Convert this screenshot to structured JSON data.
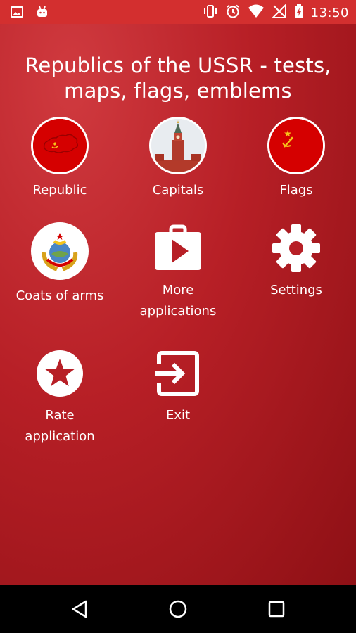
{
  "status_bar": {
    "time": "13:50",
    "icons": [
      "image-icon",
      "android-icon",
      "vibrate-icon",
      "alarm-icon",
      "wifi-icon",
      "no-signal-icon",
      "battery-charging-icon"
    ]
  },
  "app": {
    "title": "Republics of the USSR - tests, maps, flags, emblems"
  },
  "menu": {
    "republic": "Republic",
    "capitals": "Capitals",
    "flags": "Flags",
    "coats_of_arms": "Coats of arms",
    "more_applications": "More\napplications",
    "settings": "Settings",
    "rate_application": "Rate\napplication",
    "exit": "Exit"
  },
  "colors": {
    "status_bar": "#D32F2F",
    "background": "#B71F26",
    "flag_red": "#D50000",
    "gold": "#F6C51A"
  }
}
